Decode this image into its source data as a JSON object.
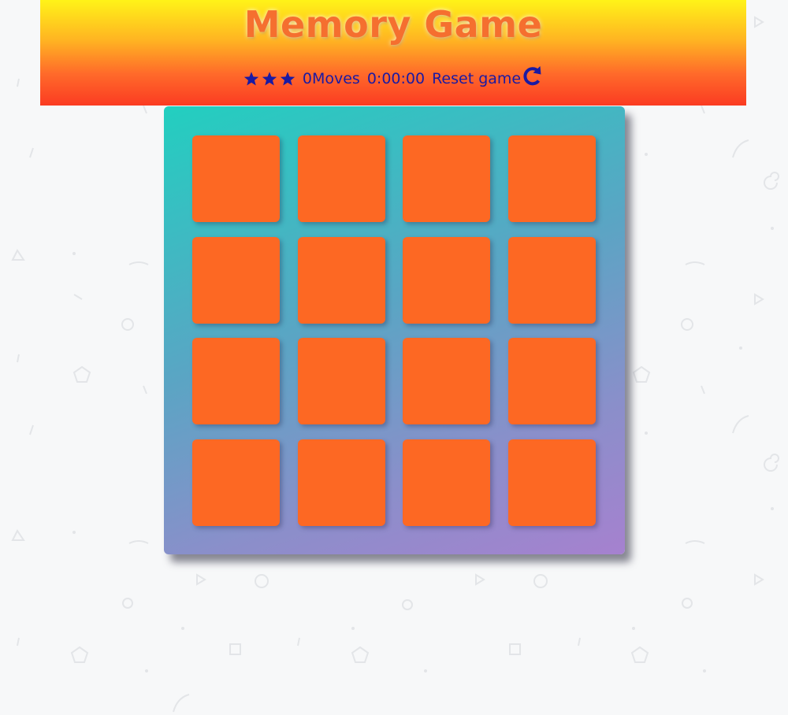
{
  "header": {
    "title": "Memory Game"
  },
  "score_panel": {
    "stars": [
      "star-icon",
      "star-icon",
      "star-icon"
    ],
    "moves_count": "0",
    "moves_label": "Moves",
    "timer": "0:00:00",
    "reset_label": "Reset game",
    "reset_icon": "restart-icon"
  },
  "deck": {
    "rows": 4,
    "columns": 4,
    "cards": [
      {
        "state": "face-down"
      },
      {
        "state": "face-down"
      },
      {
        "state": "face-down"
      },
      {
        "state": "face-down"
      },
      {
        "state": "face-down"
      },
      {
        "state": "face-down"
      },
      {
        "state": "face-down"
      },
      {
        "state": "face-down"
      },
      {
        "state": "face-down"
      },
      {
        "state": "face-down"
      },
      {
        "state": "face-down"
      },
      {
        "state": "face-down"
      },
      {
        "state": "face-down"
      },
      {
        "state": "face-down"
      },
      {
        "state": "face-down"
      },
      {
        "state": "face-down"
      }
    ]
  },
  "colors": {
    "card_back": "#fd6823",
    "score_text": "#1a1aa3",
    "title": "#f56f2f",
    "deck_gradient_start": "#22cfc0",
    "deck_gradient_end": "#a681cf",
    "header_gradient_top": "#fff318",
    "header_gradient_bottom": "#fb3b22"
  }
}
